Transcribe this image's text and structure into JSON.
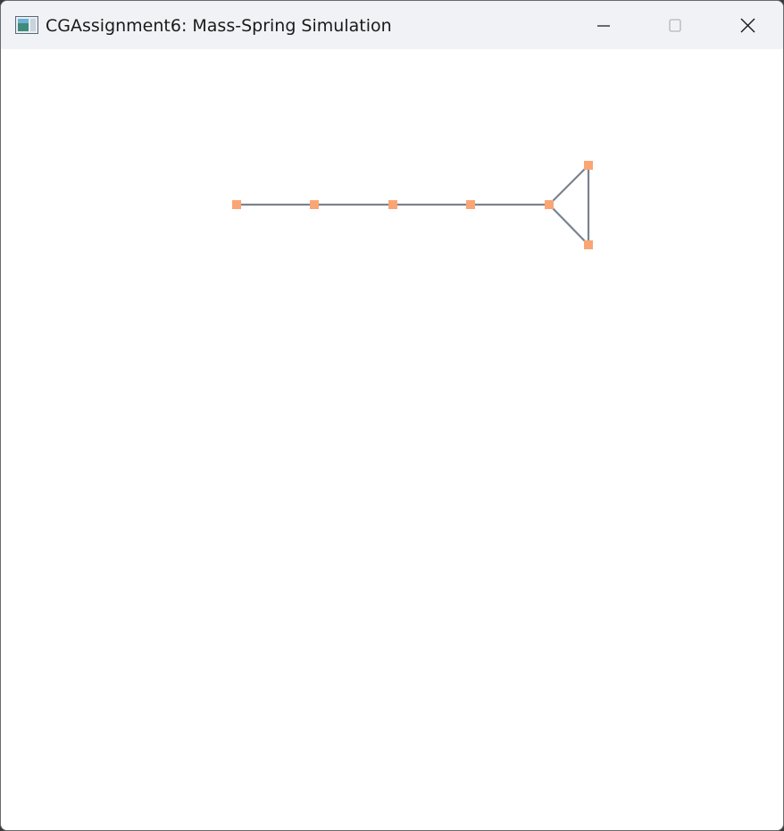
{
  "window": {
    "title": "CGAssignment6: Mass-Spring Simulation",
    "app_icon": "app-window-icon",
    "controls": [
      {
        "name": "minimize-icon"
      },
      {
        "name": "maximize-icon"
      },
      {
        "name": "close-icon"
      }
    ]
  },
  "colors": {
    "mass": "#fba574",
    "spring": "#7a8290",
    "titlebar": "#f1f2f6"
  }
}
